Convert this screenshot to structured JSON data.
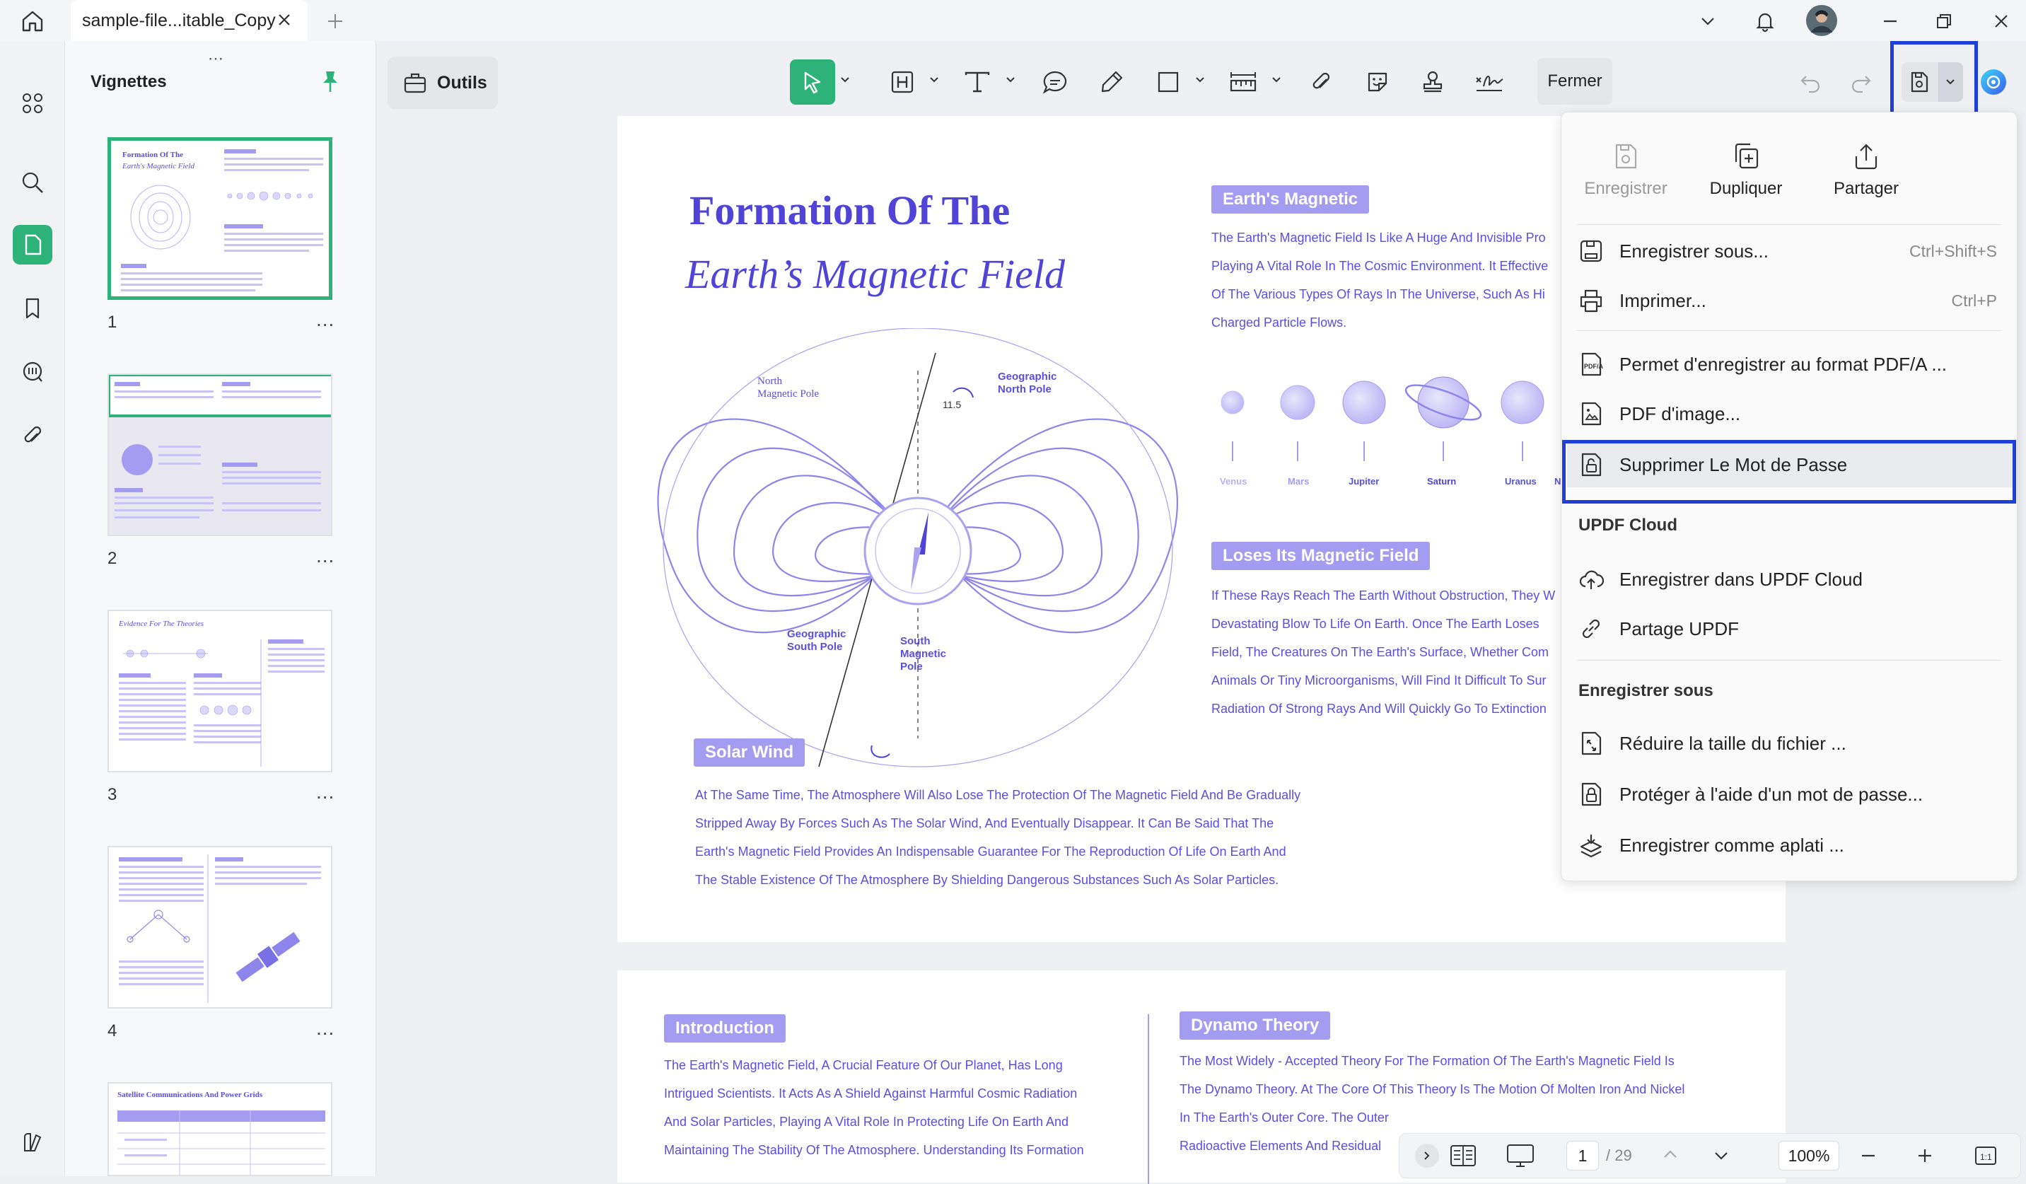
{
  "tab": {
    "title": "sample-file...itable_Copy"
  },
  "thumbnails": {
    "title": "Vignettes",
    "pages": [
      {
        "num": "1",
        "header": "Formation Of The",
        "subheader": "Earth's Magnetic Field"
      },
      {
        "num": "2"
      },
      {
        "num": "3",
        "header": "Evidence For The Theories"
      },
      {
        "num": "4"
      },
      {
        "num": "5",
        "header": "Satellite Communications And Power Grids"
      }
    ],
    "more": "..."
  },
  "toolbar": {
    "outils_label": "Outils",
    "fermer_label": "Fermer"
  },
  "document": {
    "title_line1": "Formation Of The",
    "title_line2": "Earth’s Magnetic Field",
    "diagram": {
      "north_magnetic": [
        "North",
        "Magnetic Pole"
      ],
      "geo_north": [
        "Geographic",
        "North Pole"
      ],
      "angle": "11.5",
      "geo_south": [
        "Geographic",
        "South Pole"
      ],
      "south_magnetic": [
        "South",
        "Magnetic",
        "Pole"
      ]
    },
    "earth_magnetic": {
      "heading": "Earth's Magnetic",
      "lines": [
        "The Earth's Magnetic Field Is Like A Huge And Invisible Pro",
        "Playing A Vital Role In The Cosmic Environment. It Effective",
        "Of The Various Types Of Rays In The Universe, Such As Hi",
        "Charged Particle Flows."
      ]
    },
    "planets": [
      "Venus",
      "Mars",
      "Jupiter",
      "Saturn",
      "Uranus",
      "N"
    ],
    "loses": {
      "heading": "Loses Its Magnetic Field",
      "lines": [
        "If These Rays Reach The Earth Without Obstruction, They W",
        "Devastating Blow To Life On Earth. Once The Earth Loses",
        "Field, The Creatures On The Earth's Surface, Whether Com",
        "Animals Or Tiny Microorganisms, Will Find It Difficult To Sur",
        "Radiation Of Strong Rays And Will Quickly Go To Extinction"
      ]
    },
    "solar_wind": {
      "heading": "Solar Wind",
      "lines": [
        "At The Same Time, The Atmosphere Will Also Lose The Protection Of The Magnetic Field And Be Gradually",
        "Stripped Away By Forces Such As The Solar Wind, And Eventually Disappear. It Can Be Said That The",
        "Earth's Magnetic Field Provides An Indispensable Guarantee For The Reproduction Of Life On Earth And",
        "The Stable Existence Of The Atmosphere By Shielding Dangerous Substances Such As Solar Particles."
      ]
    },
    "introduction": {
      "heading": "Introduction",
      "lines": [
        "The Earth's Magnetic Field, A Crucial Feature Of Our Planet, Has Long",
        "Intrigued Scientists. It Acts As A Shield Against Harmful Cosmic Radiation",
        "And Solar Particles, Playing A Vital Role In Protecting Life On Earth And",
        "Maintaining The Stability Of The Atmosphere. Understanding Its Formation"
      ]
    },
    "dynamo": {
      "heading": "Dynamo Theory",
      "lines": [
        "The Most Widely - Accepted Theory For The Formation Of The Earth's Magnetic Field Is",
        "The Dynamo Theory. At The Core Of This Theory Is The Motion Of Molten Iron And Nickel",
        "In The Earth's Outer Core. The Outer",
        "Radioactive Elements And Residual"
      ]
    }
  },
  "menu": {
    "top": [
      {
        "label": "Enregistrer",
        "disabled": true
      },
      {
        "label": "Dupliquer"
      },
      {
        "label": "Partager"
      }
    ],
    "items": [
      {
        "label": "Enregistrer sous...",
        "shortcut": "Ctrl+Shift+S"
      },
      {
        "label": "Imprimer...",
        "shortcut": "Ctrl+P"
      },
      {
        "label": "Permet d'enregistrer au format PDF/A ..."
      },
      {
        "label": "PDF d'image..."
      },
      {
        "label": "Supprimer Le Mot de Passe"
      }
    ],
    "cloud_heading": "UPDF Cloud",
    "cloud_items": [
      {
        "label": "Enregistrer dans UPDF Cloud"
      },
      {
        "label": "Partage UPDF"
      }
    ],
    "save_heading": "Enregistrer sous",
    "save_items": [
      {
        "label": "Réduire la taille du fichier ..."
      },
      {
        "label": "Protéger à l'aide d'un mot de passe..."
      },
      {
        "label": "Enregistrer comme aplati ..."
      }
    ]
  },
  "bottom": {
    "page_current": "1",
    "page_total": "/ 29",
    "zoom": "100%"
  },
  "colors": {
    "accent_green": "#2db37a",
    "doc_purple": "#5a4fe0",
    "highlight_blue": "#1f3fd6"
  }
}
